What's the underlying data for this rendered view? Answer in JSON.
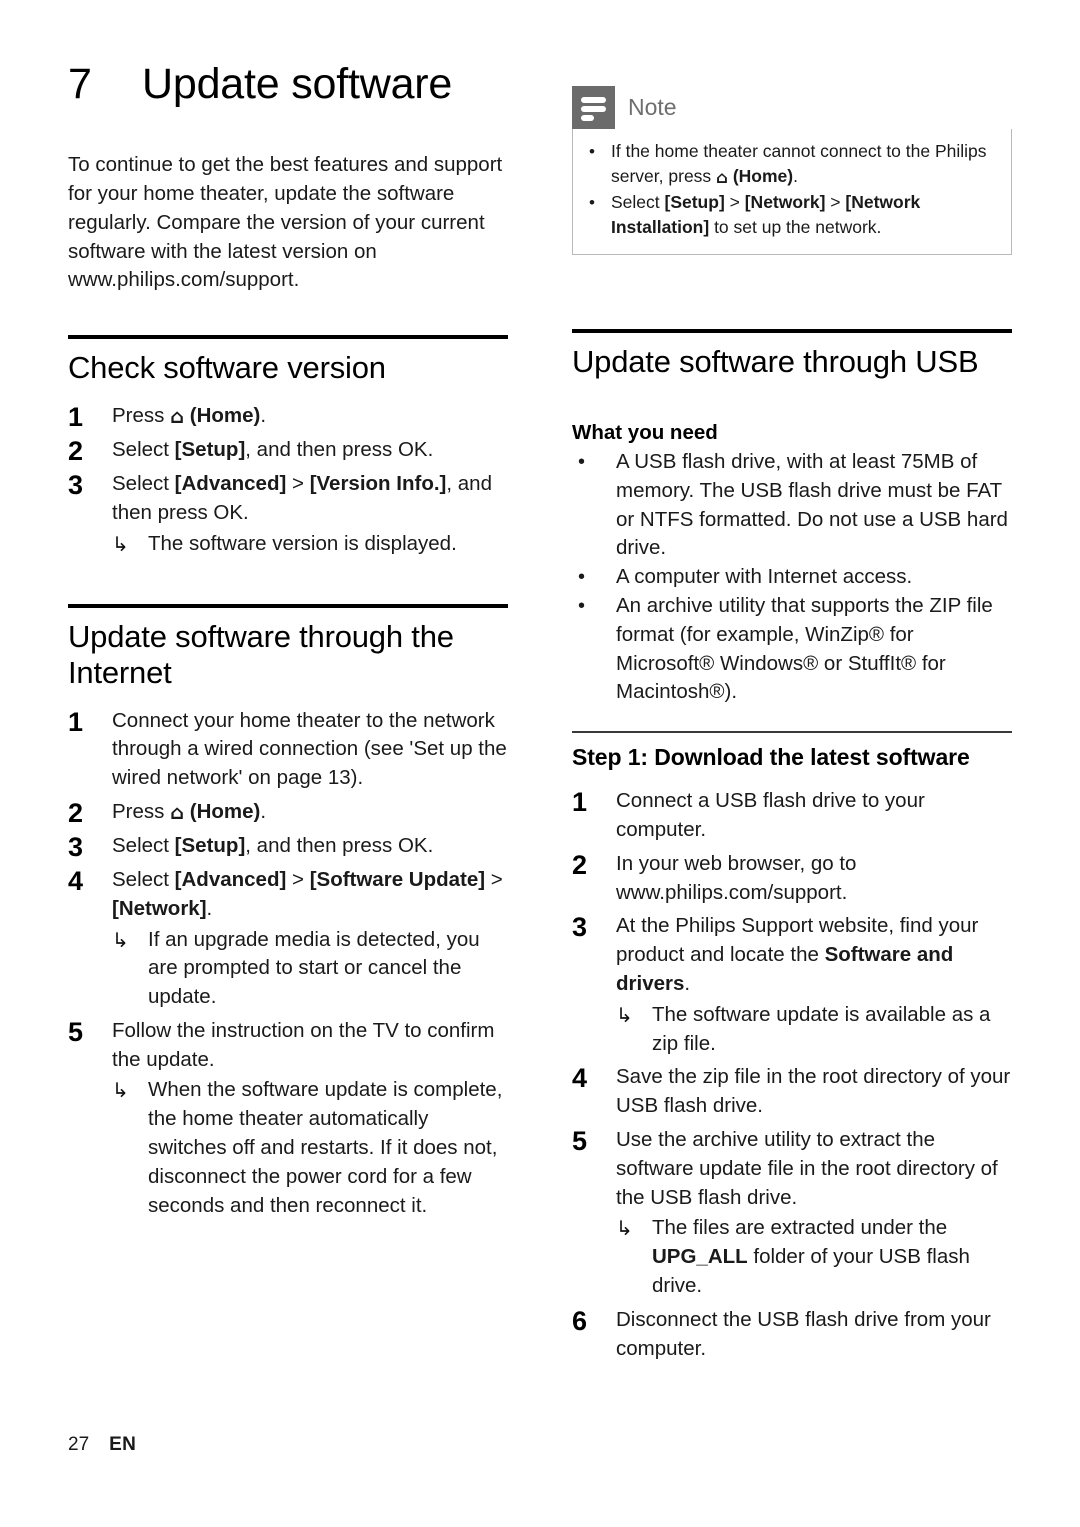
{
  "chapter": {
    "number": "7",
    "title": "Update software"
  },
  "intro": "To continue to get the best features and support for your home theater, update the software regularly. Compare the version of your current software with the latest version on www.philips.com/support.",
  "note": {
    "icon_name": "note-icon",
    "title": "Note",
    "items": [
      {
        "pre": "If the home theater cannot connect to the Philips server, press ",
        "icon": "⌂",
        "post_bold": "(Home)",
        "post": "."
      },
      {
        "pre": "Select ",
        "bold1": "[Setup]",
        "sep1": " > ",
        "bold2": "[Network]",
        "sep2": " > ",
        "bold3": "[Network Installation]",
        "post": " to set up the network."
      }
    ]
  },
  "sections": {
    "check_version": {
      "heading": "Check software version",
      "steps": [
        {
          "num": "1",
          "pre": "Press ",
          "icon": "⌂",
          "bold": "(Home)",
          "post": "."
        },
        {
          "num": "2",
          "pre": "Select ",
          "bold": "[Setup]",
          "post": ", and then press OK."
        },
        {
          "num": "3",
          "pre": "Select ",
          "bold": "[Advanced]",
          "mid": " > ",
          "bold2": "[Version Info.]",
          "post": ", and then press OK.",
          "result": "The software version is displayed."
        }
      ]
    },
    "internet": {
      "heading": "Update software through the Internet",
      "steps": [
        {
          "num": "1",
          "text": "Connect your home theater to the network through a wired connection (see 'Set up the wired network' on page 13)."
        },
        {
          "num": "2",
          "pre": "Press ",
          "icon": "⌂",
          "bold": "(Home)",
          "post": "."
        },
        {
          "num": "3",
          "pre": "Select ",
          "bold": "[Setup]",
          "post": ", and then press OK."
        },
        {
          "num": "4",
          "pre": "Select ",
          "bold": "[Advanced]",
          "mid": " > ",
          "bold2": "[Software Update]",
          "mid2": " > ",
          "bold3": "[Network]",
          "post": ".",
          "result": "If an upgrade media is detected, you are prompted to start or cancel the update."
        },
        {
          "num": "5",
          "text": "Follow the instruction on the TV to confirm the update.",
          "result": "When the software update is complete, the home theater automatically switches off and restarts. If it does not, disconnect the power cord for a few seconds and then reconnect it."
        }
      ]
    },
    "usb": {
      "heading": "Update software through USB",
      "what_you_need": {
        "label": "What you need",
        "bullets": [
          "A USB flash drive, with at least 75MB of memory. The USB flash drive must be FAT or NTFS formatted. Do not use a USB hard drive.",
          "A computer with Internet access.",
          "An archive utility that supports the ZIP file format (for example, WinZip® for Microsoft® Windows® or StuffIt® for Macintosh®)."
        ]
      },
      "step1": {
        "heading": "Step 1: Download the latest software",
        "steps": [
          {
            "num": "1",
            "text": "Connect a USB flash drive to your computer."
          },
          {
            "num": "2",
            "text": "In your web browser, go to www.philips.com/support."
          },
          {
            "num": "3",
            "pre": "At the Philips Support website, find your product and locate the ",
            "bold": "Software and drivers",
            "post": ".",
            "result": "The software update is available as a zip file."
          },
          {
            "num": "4",
            "text": "Save the zip file in the root directory of your USB flash drive."
          },
          {
            "num": "5",
            "text": "Use the archive utility to extract the software update file in the root directory of the USB flash drive.",
            "result_pre": "The files are extracted under the ",
            "result_bold": "UPG_ALL",
            "result_post": " folder of your USB flash drive."
          },
          {
            "num": "6",
            "text": "Disconnect the USB flash drive from your computer."
          }
        ]
      }
    }
  },
  "footer": {
    "page_number": "27",
    "language": "EN"
  }
}
